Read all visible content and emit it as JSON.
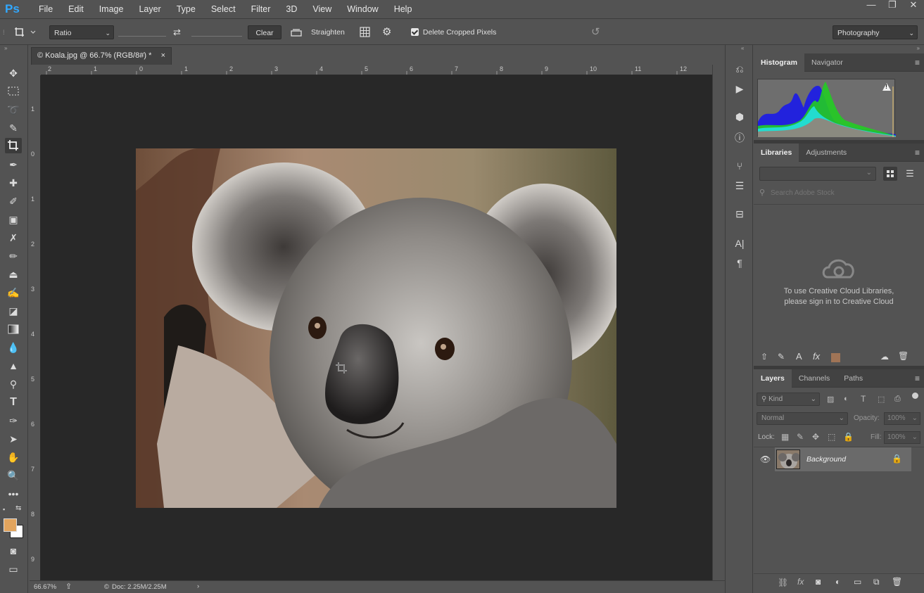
{
  "app": {
    "logo": "Ps"
  },
  "menu": [
    "File",
    "Edit",
    "Image",
    "Layer",
    "Type",
    "Select",
    "Filter",
    "3D",
    "View",
    "Window",
    "Help"
  ],
  "window_controls": {
    "minimize": "—",
    "restore": "❐",
    "close": "✕"
  },
  "options": {
    "ratio_label": "Ratio",
    "clear_label": "Clear",
    "straighten_label": "Straighten",
    "delete_cropped_label": "Delete Cropped Pixels",
    "workspace": "Photography"
  },
  "document": {
    "tab_title": "© Koala.jpg @ 66.7% (RGB/8#) *",
    "tab_close": "×",
    "ruler_top": [
      "2",
      "1",
      "0",
      "1",
      "2",
      "3",
      "4",
      "5",
      "6",
      "7",
      "8",
      "9",
      "10",
      "11",
      "12"
    ],
    "ruler_left": [
      "1",
      "0",
      "1",
      "2",
      "3",
      "4",
      "5",
      "6",
      "7",
      "8",
      "9"
    ],
    "zoom": "66.67%",
    "doc_size": "Doc: 2.25M/2.25M"
  },
  "histogram": {
    "tabs": [
      "Histogram",
      "Navigator"
    ],
    "warning": "!"
  },
  "libraries": {
    "tabs": [
      "Libraries",
      "Adjustments"
    ],
    "search_placeholder": "Search Adobe Stock",
    "signin_line1": "To use Creative Cloud Libraries,",
    "signin_line2": "please sign in to Creative Cloud"
  },
  "layers": {
    "tabs": [
      "Layers",
      "Channels",
      "Paths"
    ],
    "kind_label": "Kind",
    "blend_mode": "Normal",
    "opacity_label": "Opacity:",
    "opacity_value": "100%",
    "lock_label": "Lock:",
    "fill_label": "Fill:",
    "fill_value": "100%",
    "layer_name": "Background"
  },
  "colors": {
    "foreground": "#e2a45d",
    "background": "#ffffff",
    "ps_blue": "#31a8ff",
    "library_swatch": "#a07456"
  }
}
